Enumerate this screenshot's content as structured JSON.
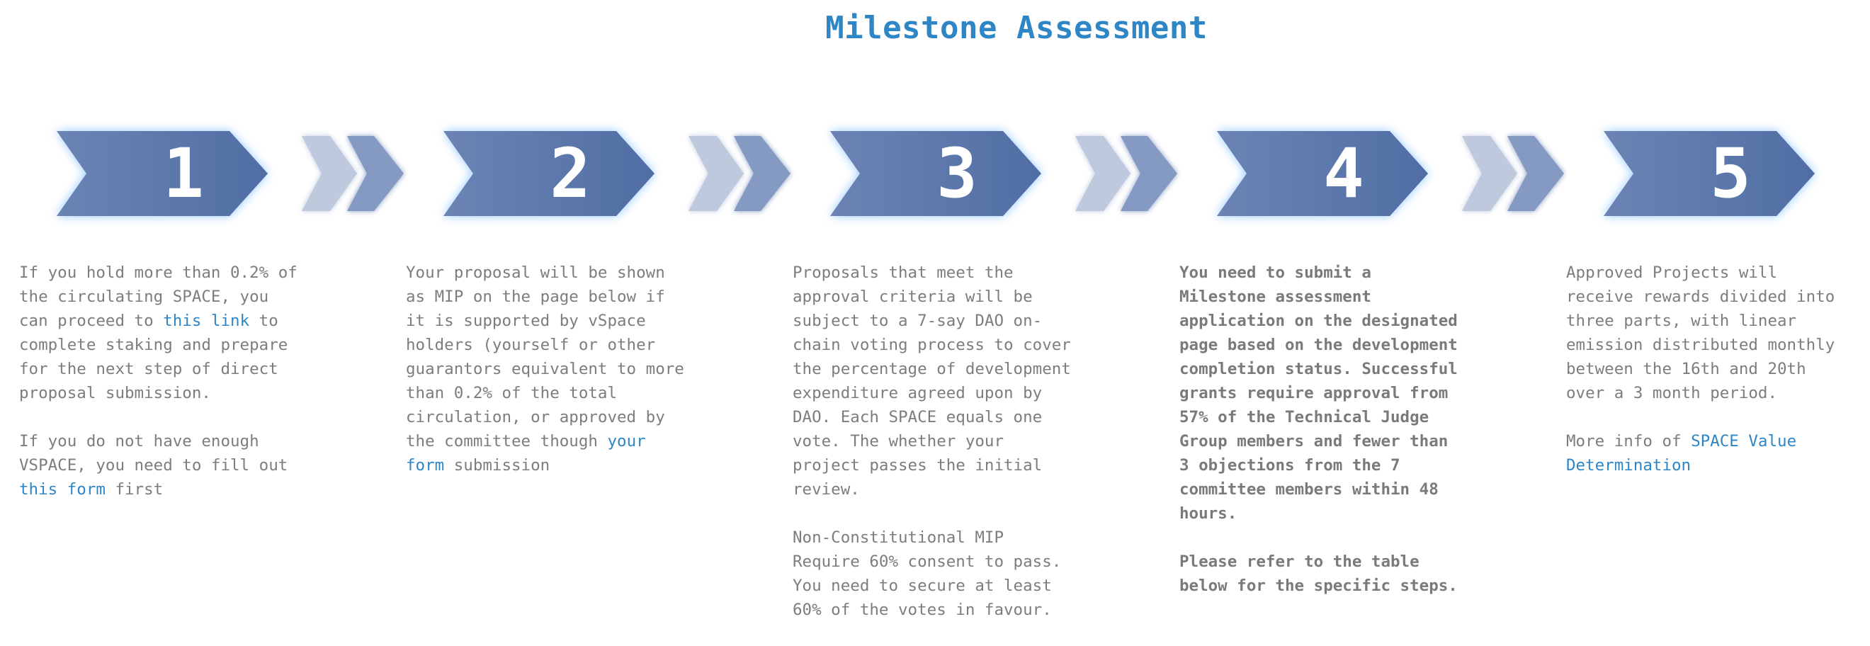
{
  "title": "Milestone Assessment",
  "colors": {
    "title": "#2f86c6",
    "badge_fill": "#5a76a8",
    "badge_glow": "#3f9bff",
    "link": "#2f86c6",
    "body_text": "#7d7d7d"
  },
  "steps": [
    {
      "number": "1",
      "paragraphs": [
        {
          "before": "If you hold more than 0.2% of the circulating SPACE, you can proceed to ",
          "link": "this link",
          "after": " to complete staking and prepare for the next step of direct proposal submission."
        },
        {
          "before": "If you do not have enough VSPACE, you need to fill out ",
          "link": "this form",
          "after": " first"
        }
      ]
    },
    {
      "number": "2",
      "paragraphs": [
        {
          "before": "Your proposal will be shown as MIP on the page below if it is supported by vSpace holders (yourself or other guarantors equivalent to more than 0.2% of the total circulation, or approved by the committee though ",
          "link": "your form",
          "after": " submission"
        }
      ]
    },
    {
      "number": "3",
      "paragraphs": [
        {
          "text": "Proposals that meet the approval criteria will be subject to a 7-say DAO on-chain voting process to cover the percentage of development expenditure agreed upon by DAO. Each SPACE equals one vote. The whether your project passes the initial review."
        },
        {
          "text": "Non-Constitutional MIP Require 60% consent to pass. You need to secure at least 60% of the votes in favour."
        }
      ]
    },
    {
      "number": "4",
      "paragraphs": [
        {
          "text": "You need to submit a Milestone assessment application on the designated page based on the development completion status. Successful grants require approval from 57% of the Technical Judge Group members and fewer than 3 objections from the 7 committee members within 48 hours."
        },
        {
          "text": "Please refer to the table below for the specific steps."
        }
      ]
    },
    {
      "number": "5",
      "paragraphs": [
        {
          "text": "Approved Projects will receive rewards divided into three parts, with linear emission distributed monthly between the 16th and 20th over a 3 month period."
        },
        {
          "before": "More info of ",
          "link": "SPACE Value Determination",
          "after": ""
        }
      ]
    }
  ],
  "icons": {
    "step_badge": "chevron-arrow",
    "connector": "double-chevron-arrow"
  }
}
